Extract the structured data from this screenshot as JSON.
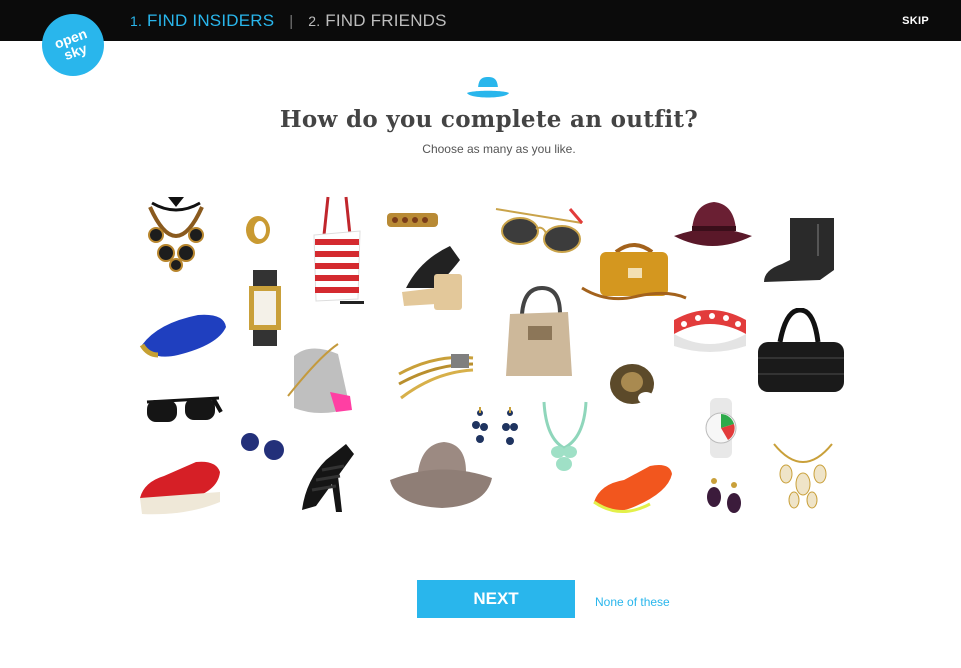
{
  "header": {
    "step1": {
      "number": "1.",
      "label": "FIND INSIDERS"
    },
    "separator": "|",
    "step2": {
      "number": "2.",
      "label": "FIND FRIENDS"
    },
    "skip_label": "SKIP"
  },
  "logo": {
    "line1": "open",
    "line2": "sky"
  },
  "prompt": {
    "title": "How do you complete an outfit?",
    "subtitle": "Choose as many as you like."
  },
  "actions": {
    "next_label": "NEXT",
    "none_label": "None of these"
  },
  "colors": {
    "accent": "#29b6ec",
    "topbar": "#0b0b0b"
  }
}
